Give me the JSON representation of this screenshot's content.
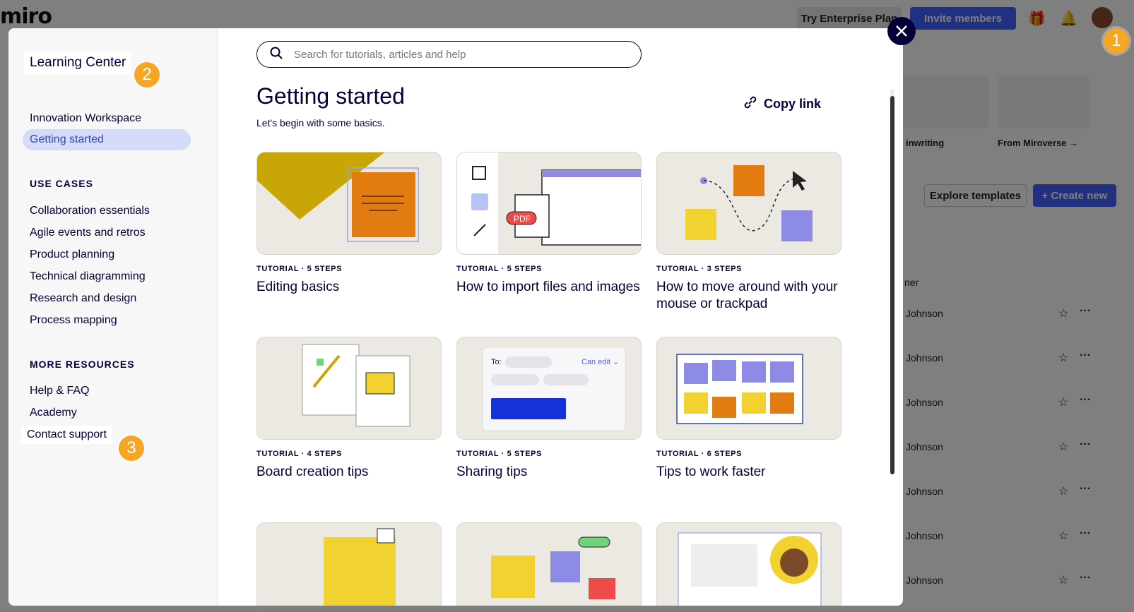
{
  "background": {
    "logo": "miro",
    "try_label": "Try Enterprise Plan",
    "invite_label": "Invite members",
    "explore_label": "Explore templates",
    "create_label": "+ Create new",
    "template_labels": [
      "inwriting",
      "From Miroverse →"
    ],
    "owner_header": "ner",
    "rows": [
      "Johnson",
      "Johnson",
      "Johnson",
      "Johnson",
      "Johnson",
      "Johnson",
      "Johnson"
    ]
  },
  "callouts": [
    "1",
    "2",
    "3"
  ],
  "sidebar": {
    "title": "Learning Center",
    "top_items": [
      "Innovation Workspace",
      "Getting started"
    ],
    "use_cases_header": "USE CASES",
    "use_cases": [
      "Collaboration essentials",
      "Agile events and retros",
      "Product planning",
      "Technical diagramming",
      "Research and design",
      "Process mapping"
    ],
    "more_header": "MORE RESOURCES",
    "more_items": [
      "Help & FAQ",
      "Academy",
      "Contact support"
    ]
  },
  "main": {
    "search_placeholder": "Search for tutorials, articles and help",
    "title": "Getting started",
    "subtitle": "Let's begin with some basics.",
    "copy_link": "Copy link",
    "cards": [
      {
        "meta": "TUTORIAL · 5 STEPS",
        "title": "Editing basics"
      },
      {
        "meta": "TUTORIAL · 5 STEPS",
        "title": "How to import files and images"
      },
      {
        "meta": "TUTORIAL · 3 STEPS",
        "title": "How to move around with your mouse or trackpad"
      },
      {
        "meta": "TUTORIAL · 4 STEPS",
        "title": "Board creation tips"
      },
      {
        "meta": "TUTORIAL · 5 STEPS",
        "title": "Sharing tips"
      },
      {
        "meta": "TUTORIAL · 6 STEPS",
        "title": "Tips to work faster"
      }
    ],
    "sharing_thumb": {
      "to": "To:",
      "can_edit": "Can edit ⌄"
    },
    "import_thumb": {
      "pdf": "PDF"
    }
  },
  "icons": {
    "close": "close-icon",
    "search": "search-icon",
    "link": "link-icon"
  }
}
